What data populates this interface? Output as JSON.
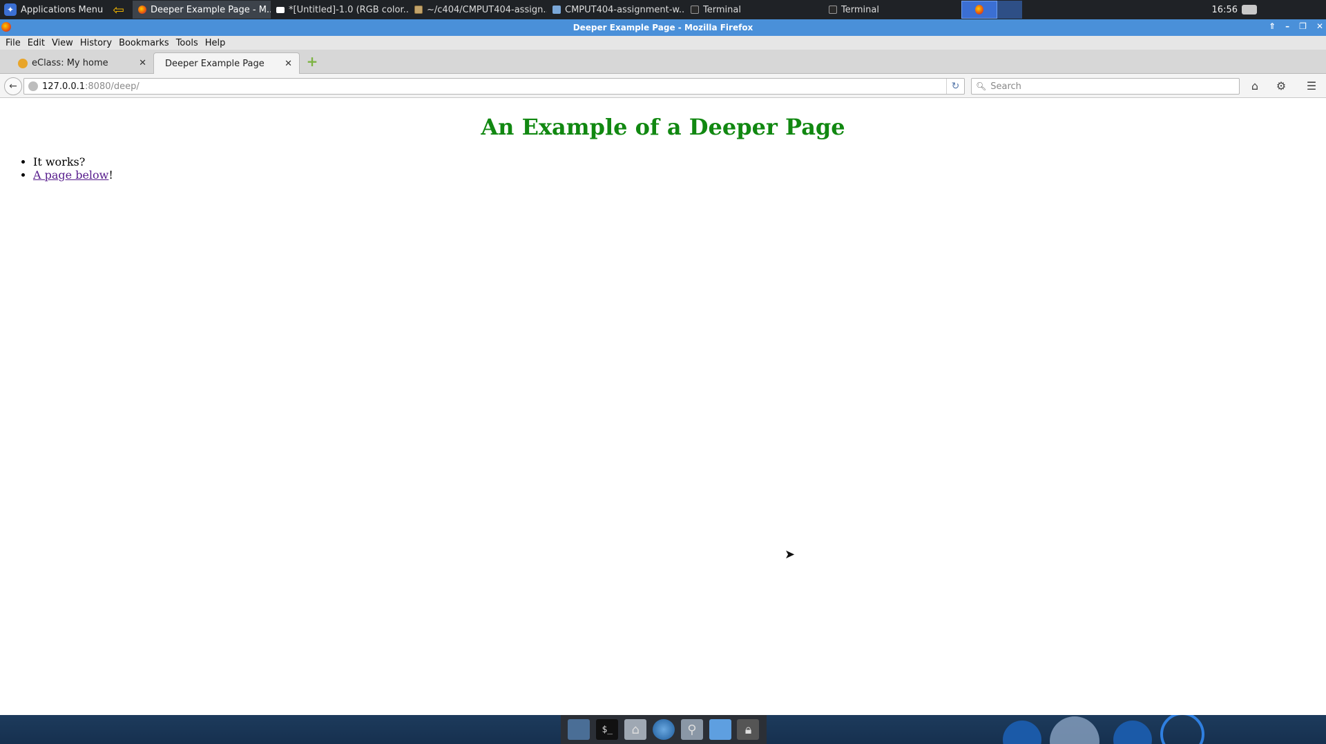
{
  "top_panel": {
    "apps_menu_label": "Applications Menu",
    "tasks": [
      {
        "label": "Deeper Example Page - M...",
        "icon": "firefox-icon",
        "active": true
      },
      {
        "label": "*[Untitled]-1.0 (RGB color...",
        "icon": "gimp-icon"
      },
      {
        "label": "~/c404/CMPUT404-assign...",
        "icon": "text-editor-icon"
      },
      {
        "label": "CMPUT404-assignment-w...",
        "icon": "folder-icon"
      },
      {
        "label": "Terminal",
        "icon": "terminal-icon"
      },
      {
        "label": "Terminal",
        "icon": "terminal-icon"
      }
    ],
    "clock": "16:56"
  },
  "window": {
    "title": "Deeper Example Page - Mozilla Firefox"
  },
  "menubar": {
    "items": [
      "File",
      "Edit",
      "View",
      "History",
      "Bookmarks",
      "Tools",
      "Help"
    ]
  },
  "tabs": [
    {
      "title": "eClass: My home",
      "active": false
    },
    {
      "title": "Deeper Example Page",
      "active": true
    }
  ],
  "navbar": {
    "url_host": "127.0.0.1",
    "url_rest": ":8080/deep/",
    "search_placeholder": "Search"
  },
  "page": {
    "title": "An Example of a Deeper Page",
    "title_color": "#118811",
    "items": [
      {
        "text": "It works?"
      },
      {
        "link_text": "A page below",
        "suffix": "!"
      }
    ]
  }
}
